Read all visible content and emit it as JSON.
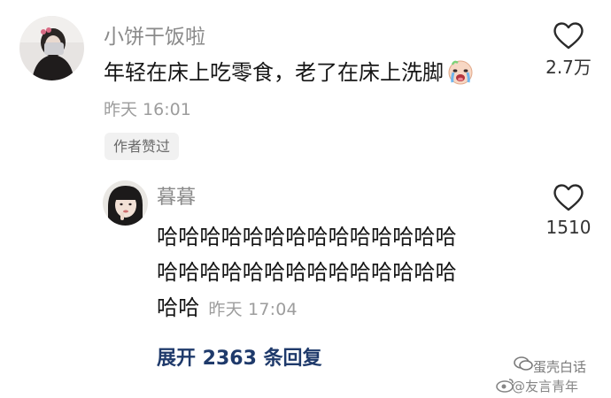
{
  "comment": {
    "username": "小饼干饭啦",
    "text": "年轻在床上吃零食，老了在床上洗脚",
    "emoji": "crying-face-icon",
    "time": "昨天 16:01",
    "badge": "作者赞过",
    "like_count": "2.7万"
  },
  "reply": {
    "username": "暮暮",
    "text_line1": "哈哈哈哈哈哈哈哈哈哈哈哈哈哈",
    "text_line2": "哈哈哈哈哈哈哈哈哈哈哈哈哈哈",
    "text_line3": "哈哈",
    "time": "昨天 17:04",
    "like_count": "1510"
  },
  "expand_replies": "展开 2363 条回复",
  "watermark": {
    "line1": "蛋壳白话",
    "line2": "@友言青年"
  },
  "colors": {
    "username": "#8a8a8a",
    "text": "#161616",
    "time": "#9d9d9d",
    "link": "#1f3a6b",
    "badge_bg": "#f1f1f1"
  }
}
